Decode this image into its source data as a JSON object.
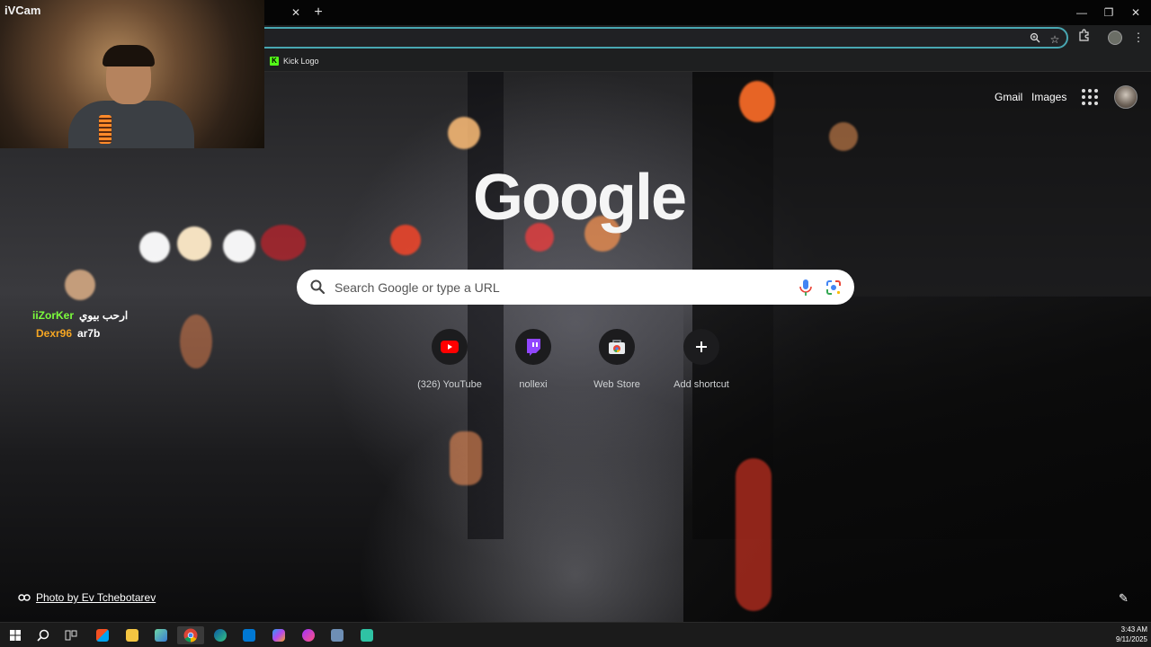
{
  "browser": {
    "bookmarks": [
      {
        "label": "Kick Logo"
      }
    ]
  },
  "ntp": {
    "top_links": {
      "gmail": "Gmail",
      "images": "Images"
    },
    "logo": "Google",
    "search": {
      "placeholder": "Search Google or type a URL",
      "value": ""
    },
    "shortcuts": [
      {
        "label": "(326) YouTube",
        "icon": "youtube-icon",
        "color": "#ff0000"
      },
      {
        "label": "nollexi",
        "icon": "twitch-icon",
        "color": "#9146ff"
      },
      {
        "label": "Web Store",
        "icon": "chrome-web-store-icon",
        "color": "#ea4335"
      },
      {
        "label": "Add shortcut",
        "icon": "plus-icon",
        "color": "#ffffff"
      }
    ],
    "photo_credit": "Photo by Ev Tchebotarev"
  },
  "webcam": {
    "title": "iVCam"
  },
  "chat": [
    {
      "user": "iiZorKer",
      "message": "ارحب بيوي",
      "user_color": "#7cfc3c"
    },
    {
      "user": "Dexr96",
      "message": "ar7b",
      "user_color": "#f5a623"
    }
  ],
  "taskbar": {
    "time": "3:43 AM",
    "date": "9/11/2025"
  }
}
